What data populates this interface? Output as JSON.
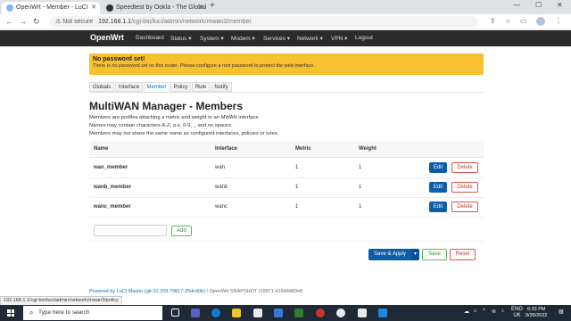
{
  "browser": {
    "tabs": [
      {
        "title": "OpenWrt - Member - LuCI",
        "active": true
      },
      {
        "title": "Speedtest by Ookla - The Global",
        "active": false
      }
    ],
    "new_tab": "+",
    "address": {
      "security": "Not secure",
      "host": "192.168.1.1",
      "path": "/cgi-bin/luci/admin/network/mwan3/member"
    },
    "status_url": "192.168.1.1/cgi-bin/luci/admin/network/mwan3/policy"
  },
  "header": {
    "brand": "OpenWrt",
    "menu": [
      "Dashboard",
      "Status ▾",
      "System ▾",
      "Modem ▾",
      "Services ▾",
      "Network ▾",
      "VPN ▾",
      "Logout"
    ]
  },
  "warning": {
    "title": "No password set!",
    "message": "There is no password set on this router. Please configure a root password to protect the web interface."
  },
  "subtabs": [
    {
      "label": "Globals",
      "active": false
    },
    {
      "label": "Interface",
      "active": false
    },
    {
      "label": "Member",
      "active": true
    },
    {
      "label": "Policy",
      "active": false
    },
    {
      "label": "Rule",
      "active": false
    },
    {
      "label": "Notify",
      "active": false
    }
  ],
  "page": {
    "title": "MultiWAN Manager - Members",
    "description": [
      "Members are profiles attaching a metric and weight to an MWAN interface.",
      "Names may contain characters A-Z, a-z, 0-9, _ and no spaces.",
      "Members may not share the same name as configured interfaces, policies or rules."
    ]
  },
  "table": {
    "headers": [
      "Name",
      "Interface",
      "Metric",
      "Weight"
    ],
    "rows": [
      {
        "name": "wan_member",
        "interface": "wan",
        "metric": "1",
        "weight": "1"
      },
      {
        "name": "wanb_member",
        "interface": "wanb",
        "metric": "1",
        "weight": "1"
      },
      {
        "name": "wanc_member",
        "interface": "wanc",
        "metric": "1",
        "weight": "1"
      }
    ],
    "edit_label": "Edit",
    "delete_label": "Delete"
  },
  "add": {
    "placeholder": "",
    "label": "Add"
  },
  "actions": {
    "save_apply": "Save & Apply",
    "caret": "▾",
    "save": "Save",
    "reset": "Reset"
  },
  "footer": {
    "powered": "Powered by LuCI Master (git-22.209.79817-25dcd0b)",
    "sep": " / ",
    "build": "OpenWrt SNAPSHOT r19971-416d4483e8"
  },
  "taskbar": {
    "search_placeholder": "Type here to search",
    "lang": "ENG",
    "region": "UK",
    "time": "6:33 PM",
    "date": "9/26/2022"
  }
}
